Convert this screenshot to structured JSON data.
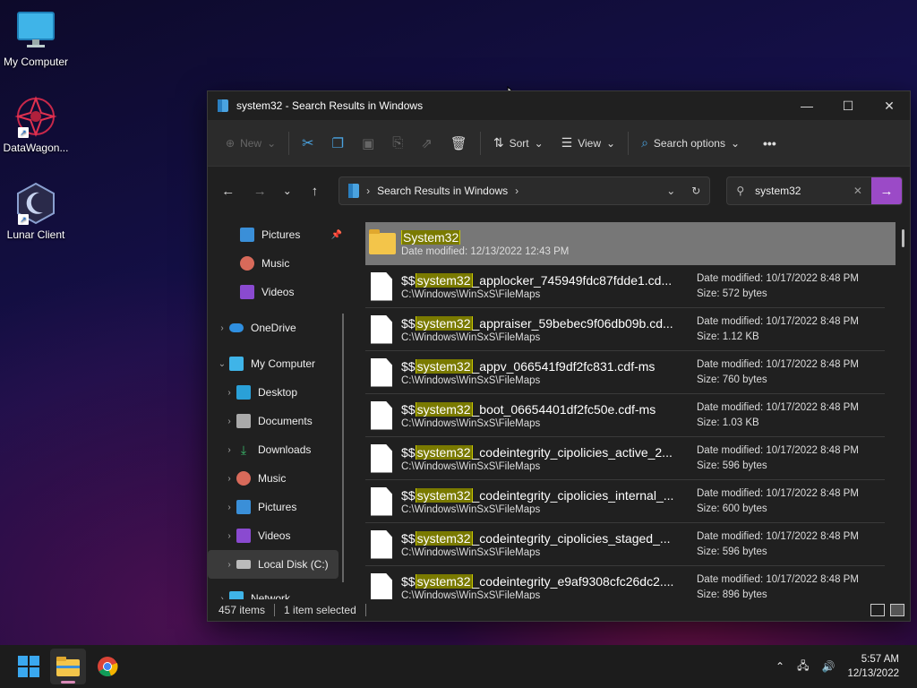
{
  "desktop": {
    "icons": [
      {
        "label": "My Computer"
      },
      {
        "label": "DataWagon..."
      },
      {
        "label": "Lunar Client"
      }
    ]
  },
  "window": {
    "title": "system32 - Search Results in Windows",
    "toolbar": {
      "new_label": "New",
      "sort_label": "Sort",
      "view_label": "View",
      "search_options_label": "Search options",
      "more_label": "•••"
    },
    "address": {
      "crumb": "Search Results in Windows"
    },
    "search": {
      "value": "system32"
    },
    "sidebar": {
      "items": [
        {
          "label": "Pictures"
        },
        {
          "label": "Music"
        },
        {
          "label": "Videos"
        },
        {
          "label": "OneDrive"
        },
        {
          "label": "My Computer"
        },
        {
          "label": "Desktop"
        },
        {
          "label": "Documents"
        },
        {
          "label": "Downloads"
        },
        {
          "label": "Music"
        },
        {
          "label": "Pictures"
        },
        {
          "label": "Videos"
        },
        {
          "label": "Local Disk (C:)"
        },
        {
          "label": "Network"
        }
      ]
    },
    "results": {
      "folder": {
        "name": "System32",
        "date_modified": "Date modified:  12/13/2022 12:43 PM"
      },
      "prefix": "$$",
      "highlight": "system32",
      "files": [
        {
          "suffix": "_applocker_745949fdc87fdde1.cd...",
          "path": "C:\\Windows\\WinSxS\\FileMaps",
          "date": "Date modified:  10/17/2022 8:48 PM",
          "size": "Size:  572 bytes"
        },
        {
          "suffix": "_appraiser_59bebec9f06db09b.cd...",
          "path": "C:\\Windows\\WinSxS\\FileMaps",
          "date": "Date modified:  10/17/2022 8:48 PM",
          "size": "Size:  1.12 KB"
        },
        {
          "suffix": "_appv_066541f9df2fc831.cdf-ms",
          "path": "C:\\Windows\\WinSxS\\FileMaps",
          "date": "Date modified:  10/17/2022 8:48 PM",
          "size": "Size:  760 bytes"
        },
        {
          "suffix": "_boot_06654401df2fc50e.cdf-ms",
          "path": "C:\\Windows\\WinSxS\\FileMaps",
          "date": "Date modified:  10/17/2022 8:48 PM",
          "size": "Size:  1.03 KB"
        },
        {
          "suffix": "_codeintegrity_cipolicies_active_2...",
          "path": "C:\\Windows\\WinSxS\\FileMaps",
          "date": "Date modified:  10/17/2022 8:48 PM",
          "size": "Size:  596 bytes"
        },
        {
          "suffix": "_codeintegrity_cipolicies_internal_...",
          "path": "C:\\Windows\\WinSxS\\FileMaps",
          "date": "Date modified:  10/17/2022 8:48 PM",
          "size": "Size:  600 bytes"
        },
        {
          "suffix": "_codeintegrity_cipolicies_staged_...",
          "path": "C:\\Windows\\WinSxS\\FileMaps",
          "date": "Date modified:  10/17/2022 8:48 PM",
          "size": "Size:  596 bytes"
        },
        {
          "suffix": "_codeintegrity_e9af9308cfc26dc2....",
          "path": "C:\\Windows\\WinSxS\\FileMaps",
          "date": "Date modified:  10/17/2022 8:48 PM",
          "size": "Size:  896 bytes"
        }
      ]
    },
    "status": {
      "items_count": "457 items",
      "selected": "1 item selected"
    }
  },
  "taskbar": {
    "time": "5:57 AM",
    "date": "12/13/2022"
  },
  "colors": {
    "accent": "#9b4ac7",
    "highlight_bg": "#7a7a00",
    "window_bg": "#202020",
    "toolbar_bg": "#2b2b2b"
  }
}
